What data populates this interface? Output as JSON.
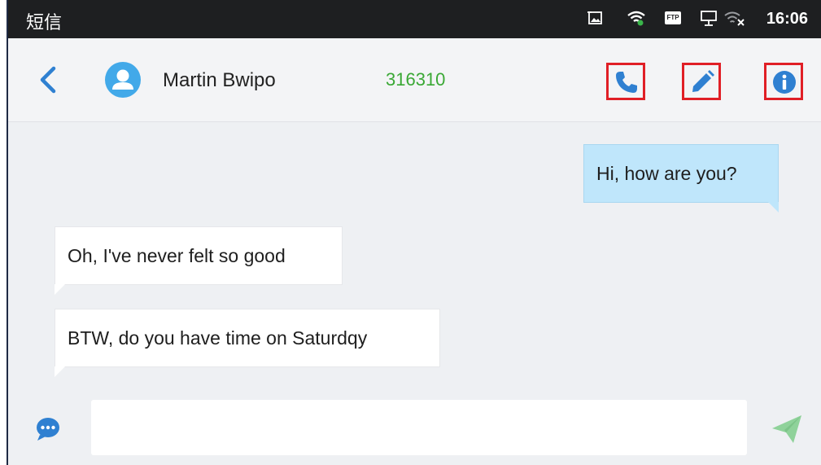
{
  "status_bar": {
    "app_name": "短信",
    "ftp_badge": "FTP",
    "time": "16:06",
    "icons": [
      "screenshot-icon",
      "wifi-icon",
      "ftp-icon",
      "network-icon",
      "wifi-off-icon"
    ]
  },
  "header": {
    "back_icon": "chevron-left-icon",
    "avatar_icon": "person-icon",
    "contact_name": "Martin Bwipo",
    "contact_number": "316310",
    "actions": [
      "phone-icon",
      "pencil-icon",
      "info-icon"
    ]
  },
  "messages": [
    {
      "direction": "outgoing",
      "text": "Hi, how are you?"
    },
    {
      "direction": "incoming",
      "text": "Oh, I've never felt so good"
    },
    {
      "direction": "incoming",
      "text": "BTW, do you have time on Saturdqy"
    }
  ],
  "composer": {
    "left_icon": "chat-bubble-icon",
    "input_value": "",
    "input_placeholder": "",
    "send_icon": "send-icon"
  },
  "colors": {
    "accent": "#2f80d1",
    "number_green": "#3aa835",
    "highlight_red": "#e01f26",
    "outgoing_bubble": "#bfe6fb",
    "send_green": "#8fd29a"
  }
}
